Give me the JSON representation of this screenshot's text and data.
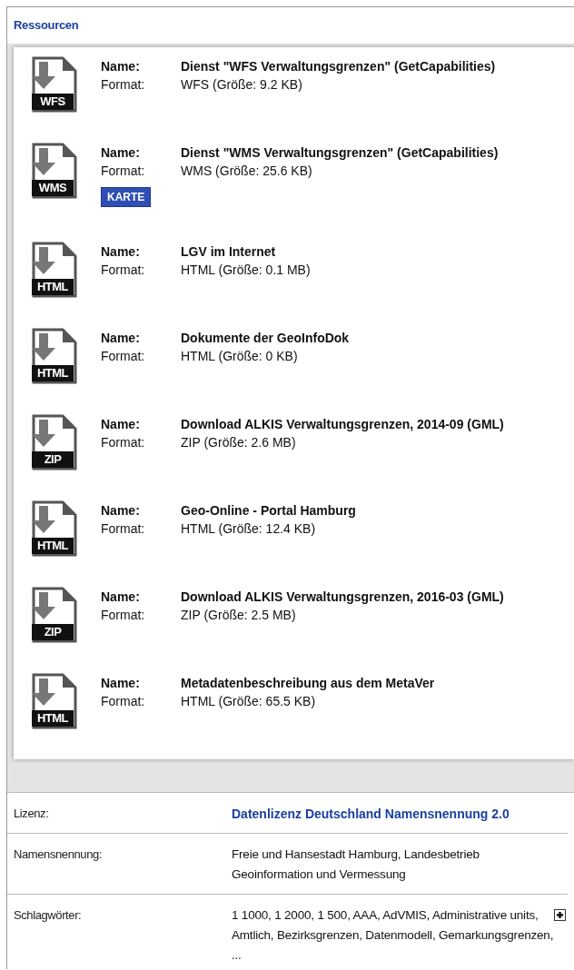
{
  "section_title": "Ressourcen",
  "resources": [
    {
      "type_label": "WFS",
      "name_label": "Name:",
      "name": "Dienst \"WFS Verwaltungsgrenzen\" (GetCapabilities)",
      "format_label": "Format:",
      "format": "WFS (Größe: 9.2 KB)"
    },
    {
      "type_label": "WMS",
      "name_label": "Name:",
      "name": "Dienst \"WMS Verwaltungsgrenzen\" (GetCapabilities)",
      "format_label": "Format:",
      "format": "WMS (Größe: 25.6 KB)",
      "button": "KARTE"
    },
    {
      "type_label": "HTML",
      "name_label": "Name:",
      "name": "LGV im Internet",
      "format_label": "Format:",
      "format": "HTML (Größe: 0.1 MB)"
    },
    {
      "type_label": "HTML",
      "name_label": "Name:",
      "name": "Dokumente der GeoInfoDok",
      "format_label": "Format:",
      "format": "HTML (Größe: 0 KB)"
    },
    {
      "type_label": "ZIP",
      "name_label": "Name:",
      "name": "Download ALKIS Verwaltungsgrenzen, 2014-09 (GML)",
      "format_label": "Format:",
      "format": "ZIP (Größe: 2.6 MB)"
    },
    {
      "type_label": "HTML",
      "name_label": "Name:",
      "name": "Geo-Online - Portal Hamburg",
      "format_label": "Format:",
      "format": "HTML (Größe: 12.4 KB)"
    },
    {
      "type_label": "ZIP",
      "name_label": "Name:",
      "name": "Download ALKIS Verwaltungsgrenzen, 2016-03 (GML)",
      "format_label": "Format:",
      "format": "ZIP (Größe: 2.5 MB)"
    },
    {
      "type_label": "HTML",
      "name_label": "Name:",
      "name": "Metadatenbeschreibung aus dem MetaVer",
      "format_label": "Format:",
      "format": "HTML (Größe: 65.5 KB)"
    }
  ],
  "details": [
    {
      "kind": "link",
      "label": "Lizenz:",
      "value": "Datenlizenz Deutschland Namensnennung 2.0"
    },
    {
      "kind": "text",
      "label": "Namensnennung:",
      "value": "Freie und Hansestadt Hamburg, Landesbetrieb Geoinformation und Vermessung"
    },
    {
      "kind": "expandable",
      "label": "Schlagwörter:",
      "value": "1 1000, 1 2000, 1 500, AAA, AdVMIS, Administrative units, Amtlich, Bezirksgrenzen, Datenmodell, Gemarkungsgrenzen, ..."
    }
  ]
}
